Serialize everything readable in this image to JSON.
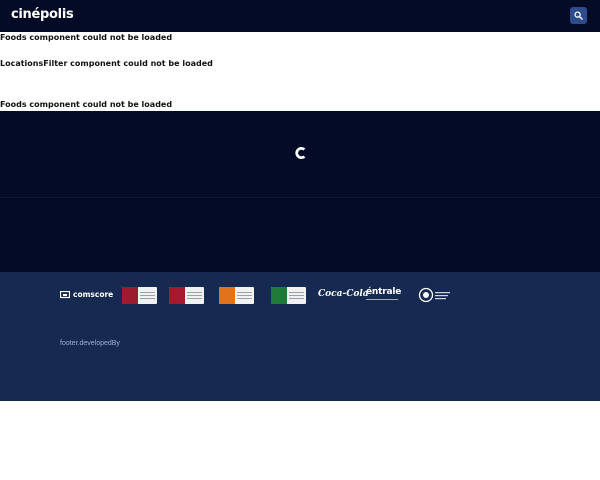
{
  "header": {
    "logo_text": "cinépolis",
    "search_button_icon": "search-icon"
  },
  "messages": [
    "Foods component could not be loaded",
    "LocationsFilter component could not be loaded",
    "Foods component could not be loaded"
  ],
  "loading": {
    "icon": "spinner-icon"
  },
  "footer": {
    "comscore_label": "comscore",
    "partner_logos": [
      "coca-cola-logo",
      "entrale-logo",
      "canacine-logo"
    ],
    "cocacola_text": "Coca-Cola",
    "entrale_text": "éntrale",
    "developed_by": "footer.developedBy"
  },
  "colors": {
    "header_bg": "#030b26",
    "footer_bg": "#162951",
    "search_btn": "#2e4b8e"
  }
}
